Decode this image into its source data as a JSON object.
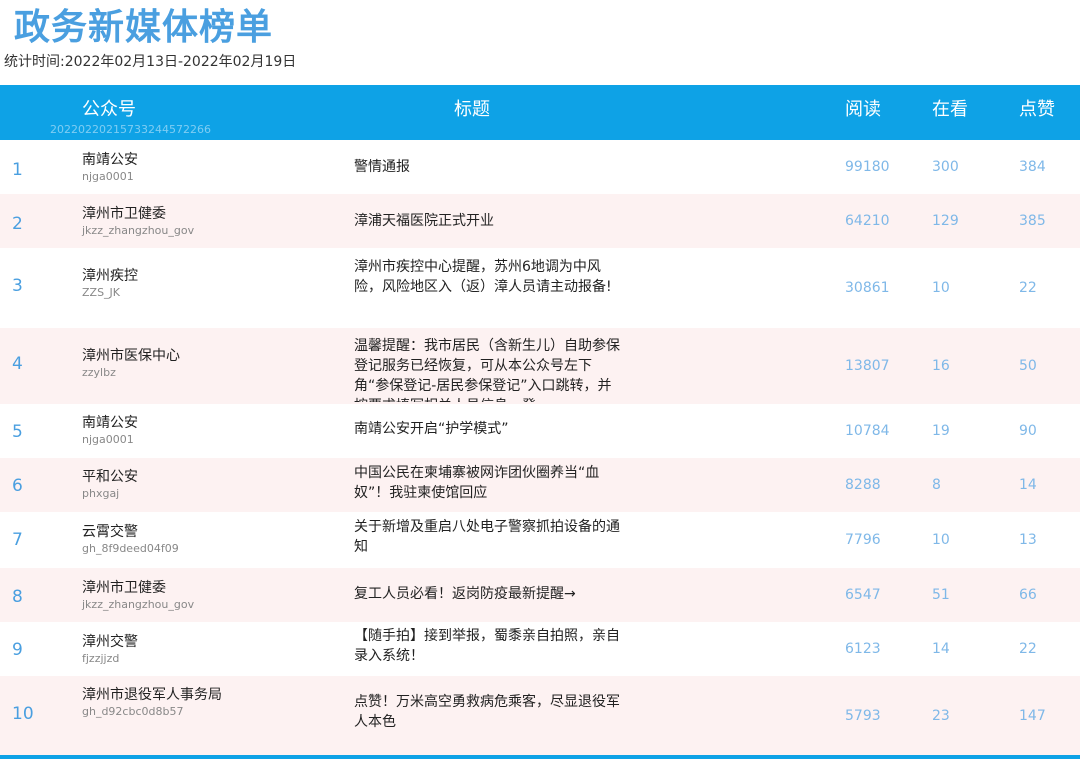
{
  "page": {
    "title": "政务新媒体榜单",
    "date_range": "统计时间:2022年02月13日-2022年02月19日"
  },
  "table": {
    "headers": {
      "account": "公众号",
      "account_id": "20220220215733244572266",
      "title": "标题",
      "read": "阅读",
      "watch": "在看",
      "like": "点赞"
    },
    "rows": [
      {
        "rank": "1",
        "name": "南靖公安",
        "id": "njga0001",
        "title": "警情通报",
        "read": "99180",
        "watch": "300",
        "like": "384"
      },
      {
        "rank": "2",
        "name": "漳州市卫健委",
        "id": "jkzz_zhangzhou_gov",
        "title": "漳浦天福医院正式开业",
        "read": "64210",
        "watch": "129",
        "like": "385"
      },
      {
        "rank": "3",
        "name": "漳州疾控",
        "id": "ZZS_JK",
        "title": "漳州市疾控中心提醒，苏州6地调为中风险，风险地区入（返）漳人员请主动报备!",
        "read": "30861",
        "watch": "10",
        "like": "22"
      },
      {
        "rank": "4",
        "name": "漳州市医保中心",
        "id": "zzylbz",
        "title": "温馨提醒：我市居民（含新生儿）自助参保登记服务已经恢复，可从本公众号左下角“参保登记-居民参保登记”入口跳转，并按要求填写相关人员信息，登",
        "read": "13807",
        "watch": "16",
        "like": "50"
      },
      {
        "rank": "5",
        "name": "南靖公安",
        "id": "njga0001",
        "title": "南靖公安开启“护学模式”",
        "read": "10784",
        "watch": "19",
        "like": "90"
      },
      {
        "rank": "6",
        "name": "平和公安",
        "id": "phxgaj",
        "title": "中国公民在柬埔寨被网诈团伙圈养当“血奴”！我驻柬使馆回应",
        "read": "8288",
        "watch": "8",
        "like": "14"
      },
      {
        "rank": "7",
        "name": "云霄交警",
        "id": "gh_8f9deed04f09",
        "title": "关于新增及重启八处电子警察抓拍设备的通知",
        "read": "7796",
        "watch": "10",
        "like": "13"
      },
      {
        "rank": "8",
        "name": "漳州市卫健委",
        "id": "jkzz_zhangzhou_gov",
        "title": "复工人员必看！返岗防疫最新提醒→",
        "read": "6547",
        "watch": "51",
        "like": "66"
      },
      {
        "rank": "9",
        "name": "漳州交警",
        "id": "fjzzjjzd",
        "title": "【随手拍】接到举报，蜀黍亲自拍照，亲自录入系统！",
        "read": "6123",
        "watch": "14",
        "like": "22"
      },
      {
        "rank": "10",
        "name": "漳州市退役军人事务局",
        "id": "gh_d92cbc0d8b57",
        "title": "点赞！万米高空勇救病危乘客，尽显退役军人本色",
        "read": "5793",
        "watch": "23",
        "like": "147"
      }
    ]
  }
}
